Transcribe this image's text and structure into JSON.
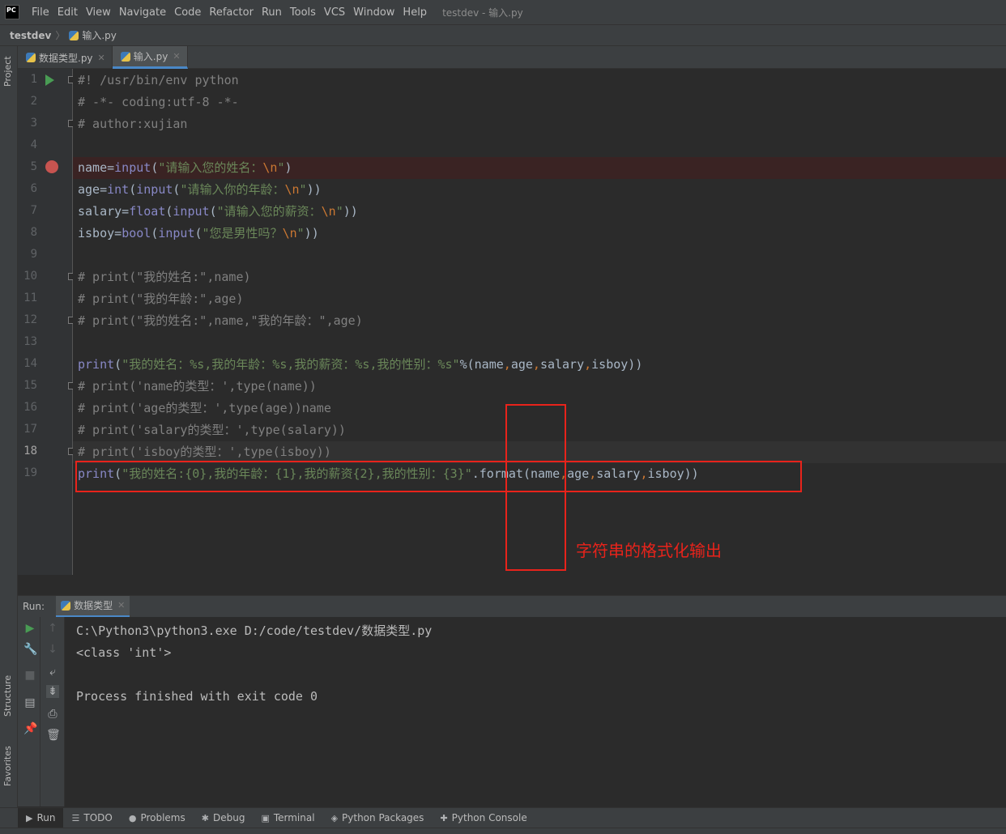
{
  "menubar": {
    "logo": "PC",
    "items": [
      "File",
      "Edit",
      "View",
      "Navigate",
      "Code",
      "Refactor",
      "Run",
      "Tools",
      "VCS",
      "Window",
      "Help"
    ],
    "window_title": "testdev - 输入.py"
  },
  "breadcrumb": {
    "project": "testdev",
    "file": "输入.py"
  },
  "left_strip": {
    "project": "Project",
    "structure": "Structure",
    "favorites": "Favorites"
  },
  "editor_tabs": [
    {
      "label": "数据类型.py",
      "active": false
    },
    {
      "label": "输入.py",
      "active": true
    }
  ],
  "editor": {
    "current_line": 18,
    "breakpoint_line": 5,
    "lines": [
      {
        "no": "1",
        "text": "#! /usr/bin/env python"
      },
      {
        "no": "2",
        "text": "# -*- coding:utf-8 -*-"
      },
      {
        "no": "3",
        "text": "# author:xujian"
      },
      {
        "no": "4",
        "text": ""
      },
      {
        "no": "5",
        "text": "name=input(\"请输入您的姓名：\\n\")"
      },
      {
        "no": "6",
        "text": "age=int(input(\"请输入你的年龄：\\n\"))"
      },
      {
        "no": "7",
        "text": "salary=float(input(\"请输入您的薪资：\\n\"))"
      },
      {
        "no": "8",
        "text": "isboy=bool(input(\"您是男性吗？\\n\"))"
      },
      {
        "no": "9",
        "text": ""
      },
      {
        "no": "10",
        "text": "# print(\"我的姓名:\",name)"
      },
      {
        "no": "11",
        "text": "# print(\"我的年龄:\",age)"
      },
      {
        "no": "12",
        "text": "# print(\"我的姓名:\",name,\"我的年龄：\",age)"
      },
      {
        "no": "13",
        "text": ""
      },
      {
        "no": "14",
        "text": "print(\"我的姓名：%s,我的年龄：%s,我的薪资：%s,我的性别：%s\"%(name,age,salary,isboy))"
      },
      {
        "no": "15",
        "text": "# print('name的类型：',type(name))"
      },
      {
        "no": "16",
        "text": "# print('age的类型：',type(age))name"
      },
      {
        "no": "17",
        "text": "# print('salary的类型：',type(salary))"
      },
      {
        "no": "18",
        "text": "# print('isboy的类型：',type(isboy))"
      },
      {
        "no": "19",
        "text": "print(\"我的姓名:{0},我的年龄：{1},我的薪资{2},我的性别：{3}\".format(name,age,salary,isboy))"
      }
    ]
  },
  "annotation": {
    "note": "字符串的格式化输出",
    "color": "#e8231b"
  },
  "run_panel": {
    "label": "Run:",
    "tab": "数据类型",
    "output": [
      "C:\\Python3\\python3.exe D:/code/testdev/数据类型.py",
      "<class 'int'>",
      "",
      "Process finished with exit code 0"
    ]
  },
  "bottom_bar": {
    "tabs": [
      {
        "label": "Run",
        "icon": "play-icon"
      },
      {
        "label": "TODO",
        "icon": "list-icon"
      },
      {
        "label": "Problems",
        "icon": "info-icon"
      },
      {
        "label": "Debug",
        "icon": "bug-icon"
      },
      {
        "label": "Terminal",
        "icon": "terminal-icon"
      },
      {
        "label": "Python Packages",
        "icon": "package-icon"
      },
      {
        "label": "Python Console",
        "icon": "python-console-icon"
      }
    ]
  },
  "colors": {
    "editor_bg": "#2b2b2b",
    "panel_bg": "#3c3f41",
    "accent": "#4a88c7",
    "comment": "#808080",
    "string": "#6a8759",
    "builtin": "#8888c6",
    "keyword": "#cc7832",
    "breakpoint": "#c75450",
    "run_green": "#499c54"
  }
}
